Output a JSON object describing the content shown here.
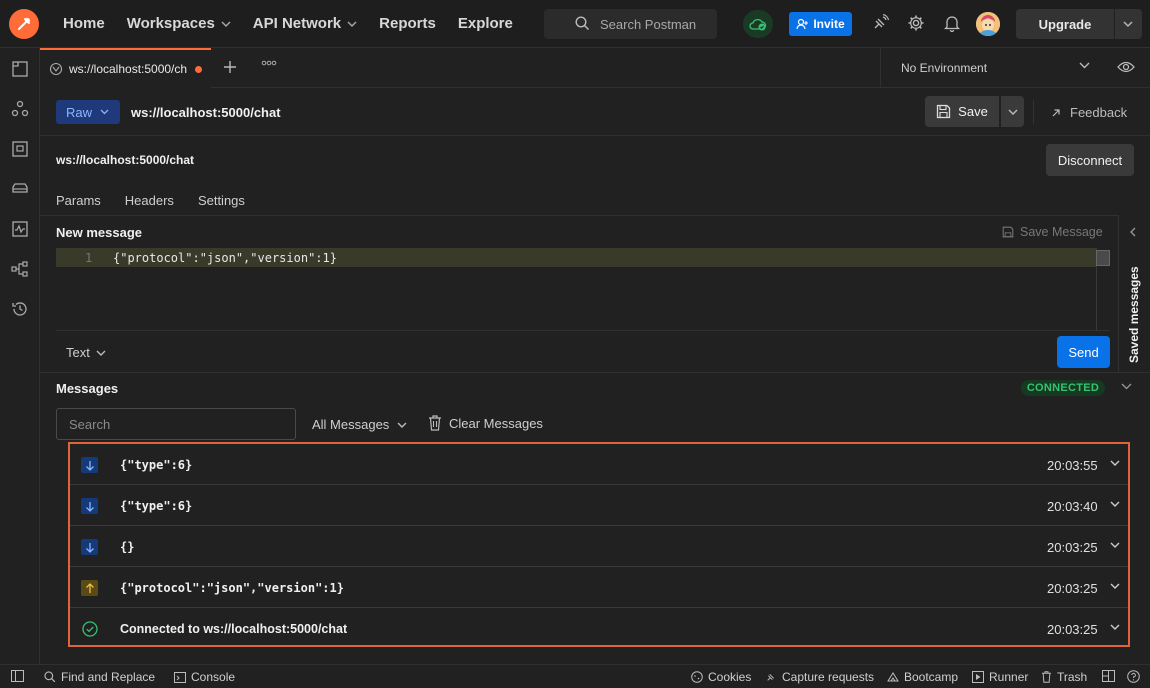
{
  "nav": {
    "home": "Home",
    "workspaces": "Workspaces",
    "api_network": "API Network",
    "reports": "Reports",
    "explore": "Explore",
    "search_placeholder": "Search Postman",
    "invite": "Invite",
    "upgrade": "Upgrade"
  },
  "tab": {
    "label": "ws://localhost:5000/ch",
    "unsaved": true
  },
  "environment": {
    "selected": "No Environment"
  },
  "request": {
    "type": "Raw",
    "title": "ws://localhost:5000/chat",
    "save_label": "Save",
    "feedback_label": "Feedback",
    "url": "ws://localhost:5000/chat",
    "disconnect_label": "Disconnect",
    "subtabs": [
      "Params",
      "Headers",
      "Settings"
    ]
  },
  "compose": {
    "title": "New message",
    "save_message_label": "Save Message",
    "line_number": "1",
    "code": "{\"protocol\":\"json\",\"version\":1}",
    "format": "Text",
    "send_label": "Send",
    "saved_messages_label": "Saved messages"
  },
  "messages": {
    "title": "Messages",
    "status": "CONNECTED",
    "search_placeholder": "Search",
    "filter": "All Messages",
    "clear_label": "Clear Messages",
    "items": [
      {
        "direction": "incoming",
        "body": "{\"type\":6}",
        "time": "20:03:55"
      },
      {
        "direction": "incoming",
        "body": "{\"type\":6}",
        "time": "20:03:40"
      },
      {
        "direction": "incoming",
        "body": "{}",
        "time": "20:03:25"
      },
      {
        "direction": "outgoing",
        "body": "{\"protocol\":\"json\",\"version\":1}",
        "time": "20:03:25"
      },
      {
        "direction": "connected",
        "body": "Connected to ws://localhost:5000/chat",
        "time": "20:03:25"
      }
    ]
  },
  "statusbar": {
    "find_replace": "Find and Replace",
    "console": "Console",
    "cookies": "Cookies",
    "capture": "Capture requests",
    "bootcamp": "Bootcamp",
    "runner": "Runner",
    "trash": "Trash"
  },
  "colors": {
    "accent": "#ff6c37",
    "primary_button": "#0a72e8",
    "connected_green": "#38c172",
    "highlight_border": "#e0643a"
  },
  "icons": [
    "postman-logo-icon",
    "search-icon",
    "cloud-sync-icon",
    "add-user-icon",
    "satellite-icon",
    "gear-icon",
    "bell-icon",
    "avatar",
    "collections-icon",
    "apis-icon",
    "environments-icon",
    "mock-servers-icon",
    "monitors-icon",
    "flows-icon",
    "history-icon",
    "websocket-icon",
    "plus-icon",
    "more-icon",
    "chevron-down-icon",
    "eye-icon",
    "save-icon",
    "arrow-up-right-icon",
    "chevron-left-icon",
    "trash-icon",
    "arrow-down-icon",
    "arrow-up-icon",
    "check-circle-icon"
  ]
}
